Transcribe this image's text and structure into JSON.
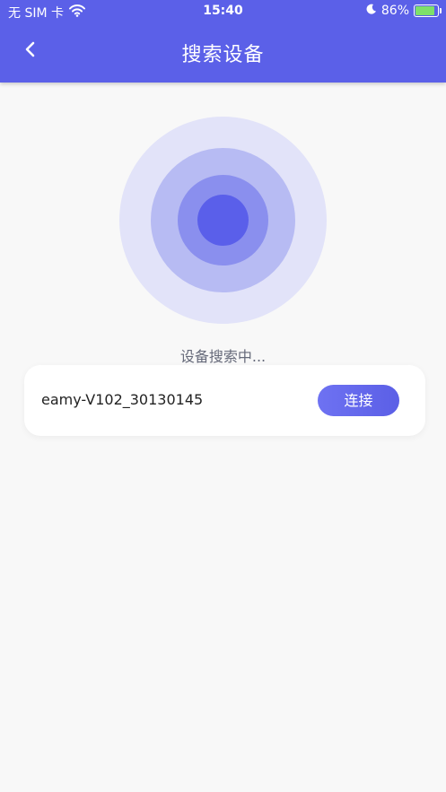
{
  "status_bar": {
    "carrier": "无 SIM 卡",
    "time": "15:40",
    "battery_percent": "86%",
    "battery_level": 0.86,
    "icons": [
      "wifi-icon",
      "moon-icon",
      "battery-charging-icon"
    ]
  },
  "header": {
    "title": "搜索设备",
    "back_icon": "chevron-left-icon"
  },
  "scan": {
    "status_text": "设备搜索中..."
  },
  "devices": [
    {
      "name": "eamy-V102_30130145",
      "action_label": "连接"
    }
  ],
  "colors": {
    "primary": "#5b60e8",
    "background": "#f8f8f8",
    "radar_outer": "#e2e3f9",
    "radar_middle": "#b7bbf3",
    "radar_inner": "#8a8fee",
    "radar_core": "#5a5fea"
  }
}
